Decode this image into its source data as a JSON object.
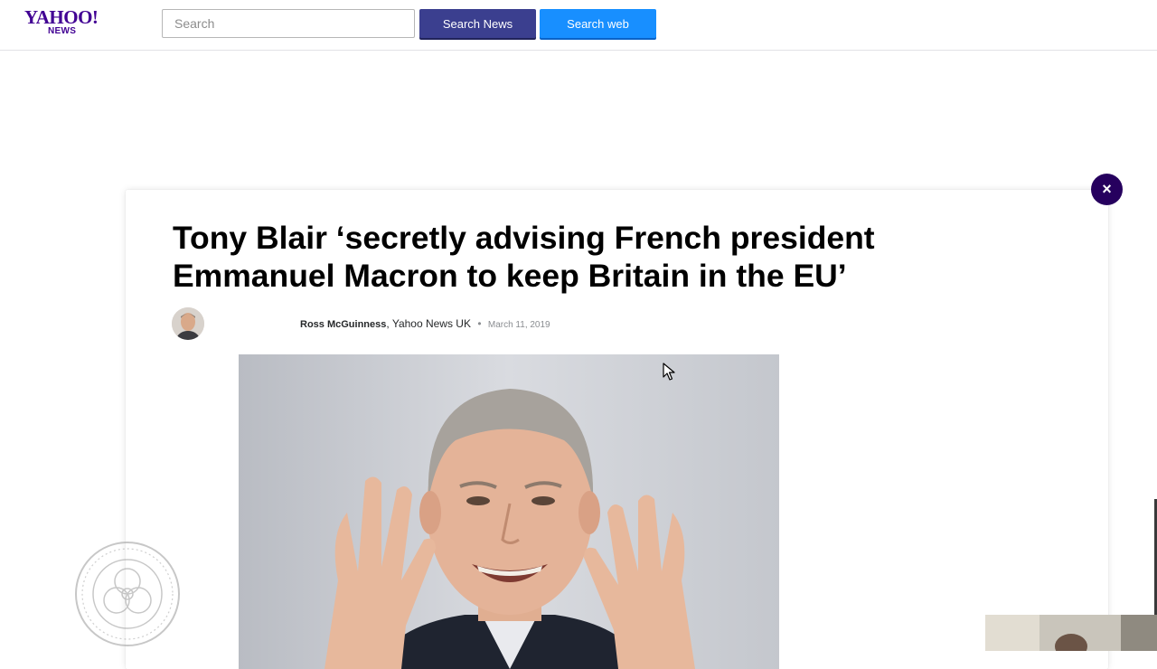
{
  "header": {
    "logo_main": "YAHOO!",
    "logo_sub": "NEWS",
    "search_placeholder": "Search",
    "search_value": "",
    "search_news_label": "Search News",
    "search_web_label": "Search web"
  },
  "article": {
    "headline": "Tony Blair ‘secretly advising French president Emmanuel Macron to keep Britain in the EU’",
    "author": "Ross McGuinness",
    "separator": ",",
    "publisher": "Yahoo News UK",
    "dot": "•",
    "date": "March 11, 2019"
  },
  "modal": {
    "close_glyph": "×"
  },
  "colors": {
    "brand_purple": "#410093",
    "search_news_button": "#3b3f8f",
    "search_web_button": "#188fff",
    "close_button": "#26005e"
  },
  "icons": [
    "close-icon",
    "cursor-icon",
    "watermark-seal"
  ]
}
